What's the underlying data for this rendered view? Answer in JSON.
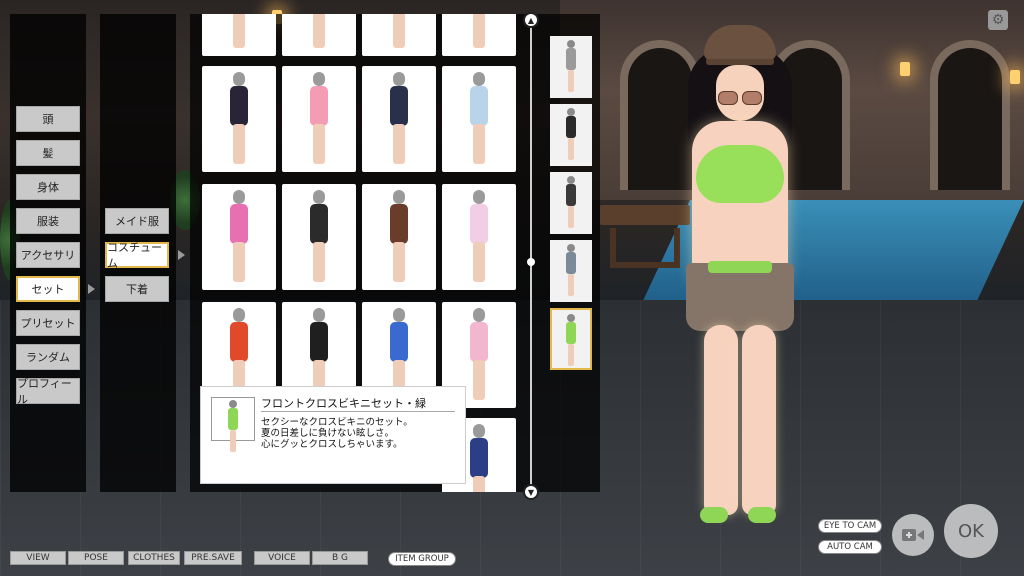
{
  "categories": [
    {
      "label": "頭",
      "active": false
    },
    {
      "label": "髪",
      "active": false
    },
    {
      "label": "身体",
      "active": false
    },
    {
      "label": "服装",
      "active": false
    },
    {
      "label": "アクセサリ",
      "active": false
    },
    {
      "label": "セット",
      "active": true
    },
    {
      "label": "プリセット",
      "active": false
    },
    {
      "label": "ランダム",
      "active": false
    },
    {
      "label": "プロフィール",
      "active": false
    }
  ],
  "subcategories": [
    {
      "label": "メイド服",
      "active": false
    },
    {
      "label": "コスチューム",
      "active": true
    },
    {
      "label": "下着",
      "active": false
    }
  ],
  "items": [
    {
      "outfit": "cut-off",
      "color": "#e8c87e"
    },
    {
      "outfit": "cut-off",
      "color": "#f2a8c0"
    },
    {
      "outfit": "cut-off",
      "color": "#333a55"
    },
    {
      "outfit": "cut-off",
      "color": "#4a3228"
    },
    {
      "outfit": "black-jacket-plaid-skirt",
      "color": "#2a2438"
    },
    {
      "outfit": "pink-lolita-dress",
      "color": "#f39cb4"
    },
    {
      "outfit": "navy-jacket-black-pants",
      "color": "#28304a"
    },
    {
      "outfit": "light-blue-dress",
      "color": "#b9d4ea"
    },
    {
      "outfit": "pink-bikini",
      "color": "#e86fb2"
    },
    {
      "outfit": "black-bikini-hat",
      "color": "#2b2b2b"
    },
    {
      "outfit": "black-crop-top",
      "color": "#6a3c2a"
    },
    {
      "outfit": "white-pink-outfit",
      "color": "#f2cde6"
    },
    {
      "outfit": "red-china-dress",
      "color": "#e04a2a"
    },
    {
      "outfit": "black-suit",
      "color": "#1f1f1f"
    },
    {
      "outfit": "sailor-uniform",
      "color": "#3a6ad0"
    },
    {
      "outfit": "pink-kimono",
      "color": "#f3b6cf"
    },
    {
      "outfit": "sailor-uniform-2",
      "color": "#2b3e86"
    }
  ],
  "selected": [
    {
      "color": "#9a9a9a"
    },
    {
      "color": "#2b2b2b"
    },
    {
      "color": "#3a3a3a"
    },
    {
      "color": "#7a8a9a"
    },
    {
      "color": "#8fd556",
      "active": true
    }
  ],
  "tooltip": {
    "title": "フロントクロスビキニセット・緑",
    "line1": "セクシーなクロスビキニのセット。",
    "line2": "夏の日差しに負けない眩しさ。",
    "line3": "心にグッとクロスしちゃいます。"
  },
  "bottom_bar": [
    "VIEW",
    "POSE",
    "CLOTHES",
    "PRE.SAVE",
    "VOICE",
    "B G"
  ],
  "item_group": "ITEM GROUP",
  "camera": {
    "eye_to_cam": "EYE TO CAM",
    "auto_cam": "AUTO CAM",
    "ok": "OK"
  }
}
